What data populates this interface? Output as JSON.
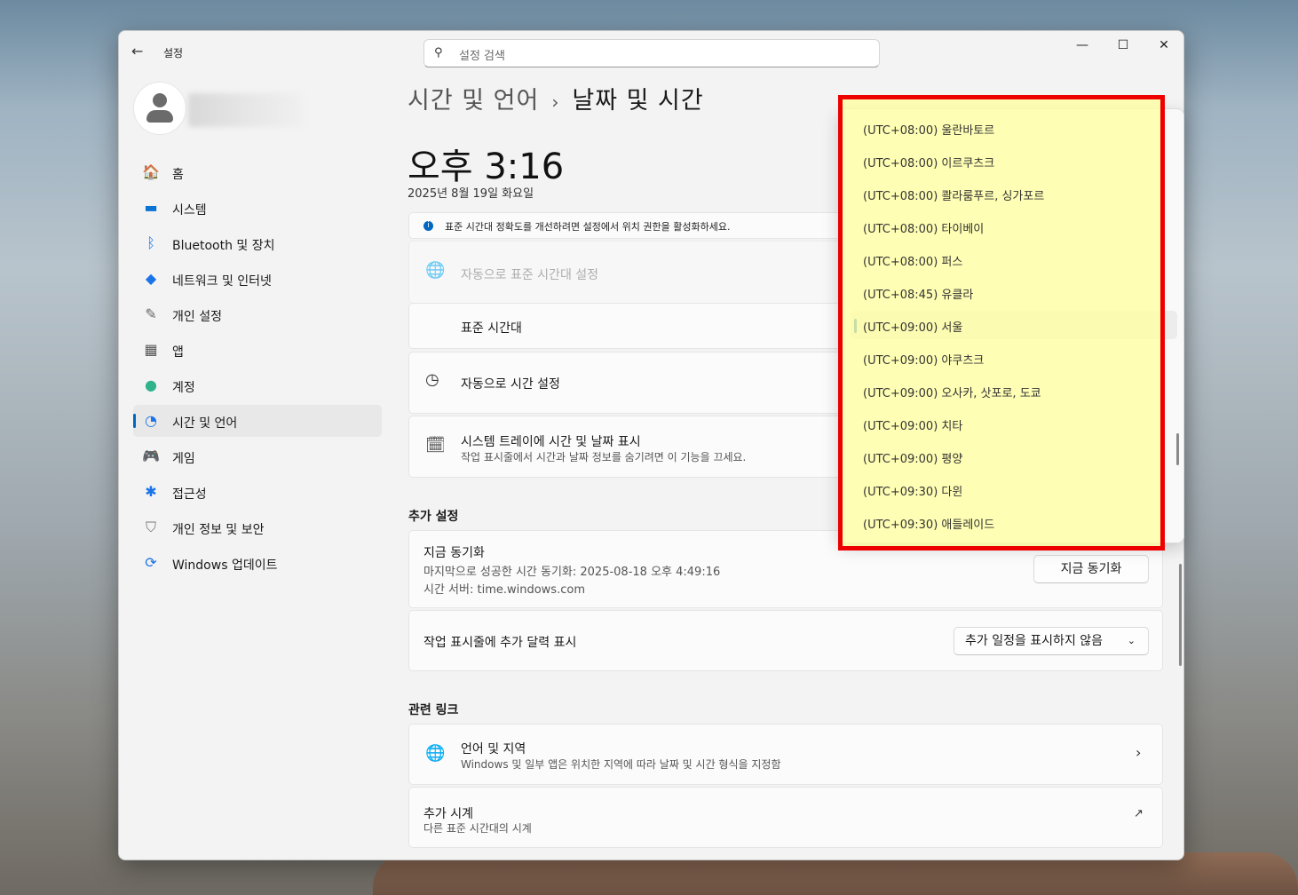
{
  "app": {
    "title": "설정"
  },
  "search": {
    "placeholder": "설정 검색"
  },
  "nav": [
    {
      "label": "홈",
      "icon": "home-icon"
    },
    {
      "label": "시스템",
      "icon": "system-icon"
    },
    {
      "label": "Bluetooth 및 장치",
      "icon": "bluetooth-icon"
    },
    {
      "label": "네트워크 및 인터넷",
      "icon": "wifi-icon"
    },
    {
      "label": "개인 설정",
      "icon": "brush-icon"
    },
    {
      "label": "앱",
      "icon": "apps-icon"
    },
    {
      "label": "계정",
      "icon": "account-icon"
    },
    {
      "label": "시간 및 언어",
      "icon": "time-language-icon",
      "active": true
    },
    {
      "label": "게임",
      "icon": "gamepad-icon"
    },
    {
      "label": "접근성",
      "icon": "accessibility-icon"
    },
    {
      "label": "개인 정보 및 보안",
      "icon": "shield-icon"
    },
    {
      "label": "Windows 업데이트",
      "icon": "update-icon"
    }
  ],
  "breadcrumb": {
    "parent": "시간 및 언어",
    "separator": "›",
    "current": "날짜 및 시간"
  },
  "clock": {
    "time": "오후 3:16",
    "date": "2025년 8월 19일 화요일"
  },
  "info": {
    "text": "표준 시간대 정확도를 개선하려면 설정에서 위치 권한을 활성화하세요."
  },
  "rows": {
    "auto_timezone": "자동으로 표준 시간대 설정",
    "timezone": "표준 시간대",
    "auto_time": "자동으로 시간 설정",
    "tray_title": "시스템 트레이에 시간 및 날짜 표시",
    "tray_sub": "작업 표시줄에서 시간과 날짜 정보를 숨기려면 이 기능을 끄세요."
  },
  "additional": {
    "heading": "추가 설정",
    "sync_title": "지금 동기화",
    "sync_last": "마지막으로 성공한 시간 동기화: 2025-08-18 오후 4:49:16",
    "sync_server": "시간 서버: time.windows.com",
    "sync_button": "지금 동기화",
    "calendar_label": "작업 표시줄에 추가 달력 표시",
    "calendar_value": "추가 일정을 표시하지 않음"
  },
  "related": {
    "heading": "관련 링크",
    "lang_title": "언어 및 지역",
    "lang_sub": "Windows 및 일부 앱은 위치한 지역에 따라 날짜 및 시간 형식을 지정함",
    "clock_title": "추가 시계",
    "clock_sub": "다른 표준 시간대의 시계"
  },
  "timezones": [
    "(UTC+08:00) 울란바토르",
    "(UTC+08:00) 이르쿠츠크",
    "(UTC+08:00) 콸라룸푸르, 싱가포르",
    "(UTC+08:00) 타이베이",
    "(UTC+08:00) 퍼스",
    "(UTC+08:45) 유클라",
    "(UTC+09:00) 서울",
    "(UTC+09:00) 야쿠츠크",
    "(UTC+09:00) 오사카, 삿포로, 도쿄",
    "(UTC+09:00) 치타",
    "(UTC+09:00) 평양",
    "(UTC+09:30) 다윈",
    "(UTC+09:30) 애들레이드"
  ],
  "selected_timezone": "(UTC+09:00) 서울",
  "colors": {
    "accent": "#0067c0",
    "highlight_border": "#ee0000",
    "highlight_fill": "#ffffa0"
  }
}
